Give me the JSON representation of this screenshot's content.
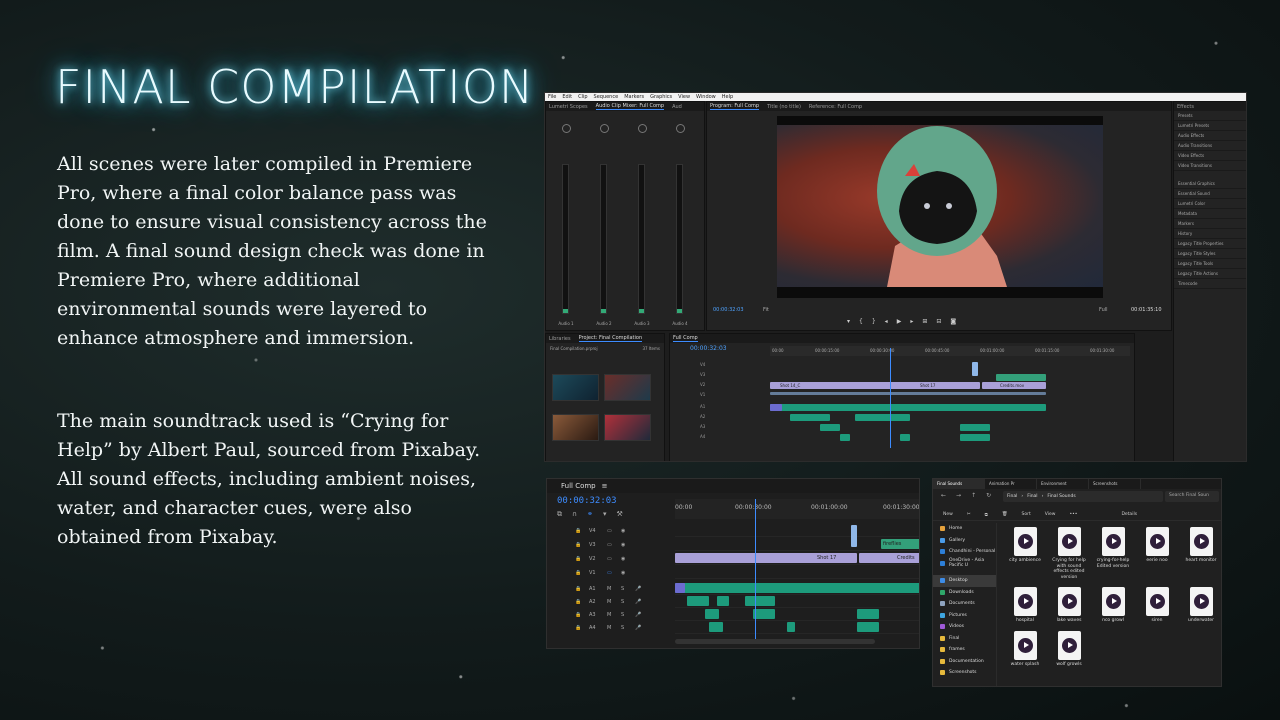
{
  "slide": {
    "title": "FINAL COMPILATION",
    "paragraph1": "All scenes were later compiled in Premiere Pro, where a final color balance pass was done to ensure visual consistency across the film. A final sound design check was done in Premiere Pro, where additional environmental sounds were layered to enhance atmosphere and immersion.",
    "paragraph2": "The main soundtrack used is “Crying for Help” by Albert Paul, sourced from Pixabay. All sound effects, including ambient noises, water, and character cues, were also obtained from Pixabay."
  },
  "premiere": {
    "menu": [
      "File",
      "Edit",
      "Clip",
      "Sequence",
      "Markers",
      "Graphics",
      "View",
      "Window",
      "Help"
    ],
    "mixer_tabs": [
      "Lumetri Scopes",
      "Audio Clip Mixer: Full Comp",
      "Aud"
    ],
    "mixer_tracks": [
      "Audio 1",
      "Audio 2",
      "Audio 3",
      "Audio 4"
    ],
    "mixer_track_ids": [
      "A1",
      "A2",
      "A3",
      "A4"
    ],
    "program_tabs": [
      "Program: Full Comp",
      "Title (no title)",
      "Reference: Full Comp"
    ],
    "program_timecode": "00:00:32:03",
    "program_duration": "00:01:35:10",
    "program_fit": "Fit",
    "program_quality": "Full",
    "effects_header": "Effects",
    "effects_items": [
      "Presets",
      "Lumetri Presets",
      "Audio Effects",
      "Audio Transitions",
      "Video Effects",
      "Video Transitions"
    ],
    "side_panels": [
      "Essential Graphics",
      "Essential Sound",
      "Lumetri Color",
      "Metadata",
      "Markers",
      "History",
      "Legacy Title Properties",
      "Legacy Title Styles",
      "Legacy Title Tools",
      "Legacy Title Actions",
      "Timecode"
    ],
    "project_tabs": [
      "Libraries",
      "Project: Final Compilation"
    ],
    "project_file": "Final Compilation.prproj",
    "project_count": "37 Items",
    "timeline_tab": "Full Comp",
    "timeline_timecode": "00:00:32:03",
    "timeline_ruler": [
      "00:00",
      "00:00:15:00",
      "00:00:30:00",
      "00:00:45:00",
      "00:01:00:00",
      "00:01:15:00",
      "00:01:30:00"
    ],
    "clip_labels": [
      "Shot 14_C",
      "Shot 17",
      "Credits.mov"
    ],
    "tracks_v": [
      "V4",
      "V3",
      "V2",
      "V1"
    ],
    "tracks_a": [
      "A1",
      "A2",
      "A3",
      "A4"
    ]
  },
  "zoom_timeline": {
    "tab": "Full Comp",
    "timecode": "00:00:32:03",
    "ruler": [
      "00:00",
      "00:00:30:00",
      "00:01:00:00",
      "00:01:30:00"
    ],
    "tracks": [
      "V4",
      "V3",
      "V2",
      "V1",
      "A1",
      "A2",
      "A3",
      "A4"
    ],
    "clips": {
      "fireflies": "fireflies",
      "shot17": "Shot 17",
      "credits": "Credits"
    },
    "track_buttons": {
      "mute": "M",
      "solo": "S"
    }
  },
  "explorer": {
    "tabs": [
      "Final Sounds",
      "Animation Pr",
      "Environment",
      "Screenshots"
    ],
    "path": [
      "Final",
      "Final",
      "Final Sounds"
    ],
    "search_placeholder": "Search Final Soun",
    "toolbar": [
      "New",
      "Sort",
      "View",
      "•••",
      "Details"
    ],
    "nav": [
      "Home",
      "Gallery",
      "Chandhini - Personal",
      "OneDrive - Asia Pacific U",
      "Desktop",
      "Downloads",
      "Documents",
      "Pictures",
      "Videos",
      "Final",
      "frames",
      "Documentation",
      "Screenshots"
    ],
    "files": [
      "city ambience",
      "Crying for help with sound effects edited version",
      "crying-for-help Edited version",
      "eerie noo",
      "heart monitor",
      "hospital",
      "lake waves",
      "nco growl",
      "siren",
      "underwater",
      "water splash",
      "wolf growls"
    ]
  }
}
